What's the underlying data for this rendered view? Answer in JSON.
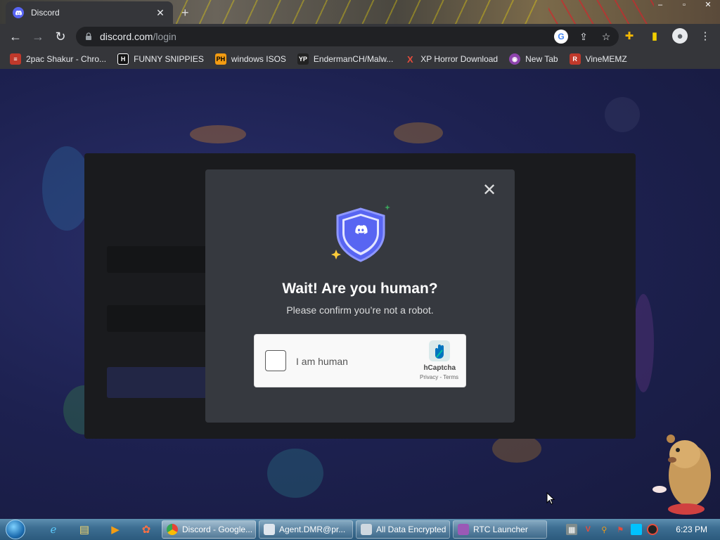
{
  "browser": {
    "tab_title": "Discord",
    "tab_close": "✕",
    "new_tab": "+",
    "url_host": "discord.com",
    "url_path": "/login",
    "window_controls": [
      "–",
      "▫",
      "✕"
    ]
  },
  "bookmarks": [
    {
      "label": "2pac Shakur - Chro...",
      "icon_color": "#c0392b",
      "icon_text": "≡"
    },
    {
      "label": "FUNNY SNIPPIES",
      "icon_color": "#111111",
      "icon_text": "H"
    },
    {
      "label": "windows ISOS",
      "icon_color": "#f39c12",
      "icon_text": "PH"
    },
    {
      "label": "EndermanCH/Malw...",
      "icon_color": "#222222",
      "icon_text": "YP"
    },
    {
      "label": "XP Horror Download",
      "icon_color": "#e74c3c",
      "icon_text": "X"
    },
    {
      "label": "New Tab",
      "icon_color": "#8e44ad",
      "icon_text": "◉"
    },
    {
      "label": "VineMEMZ",
      "icon_color": "#c0392b",
      "icon_text": "R"
    }
  ],
  "modal": {
    "close": "✕",
    "title": "Wait! Are you human?",
    "subtitle": "Please confirm you’re not a robot.",
    "captcha_label": "I am human",
    "captcha_brand": "hCaptcha",
    "captcha_links": "Privacy - Terms"
  },
  "taskbar": {
    "windows": [
      {
        "label": "Discord - Google...",
        "icon_color": "#e8eaed",
        "active": true
      },
      {
        "label": "Agent.DMR@pr...",
        "icon_color": "#dfe6ee",
        "active": false
      },
      {
        "label": "All Data Encrypted",
        "icon_color": "#cfd8e0",
        "active": false
      },
      {
        "label": "RTC Launcher",
        "icon_color": "#9b59b6",
        "active": false
      }
    ],
    "clock": "6:23 PM"
  },
  "colors": {
    "blurple": "#5865f2",
    "modal_bg": "#36393f",
    "browser_chrome": "#35363a"
  }
}
